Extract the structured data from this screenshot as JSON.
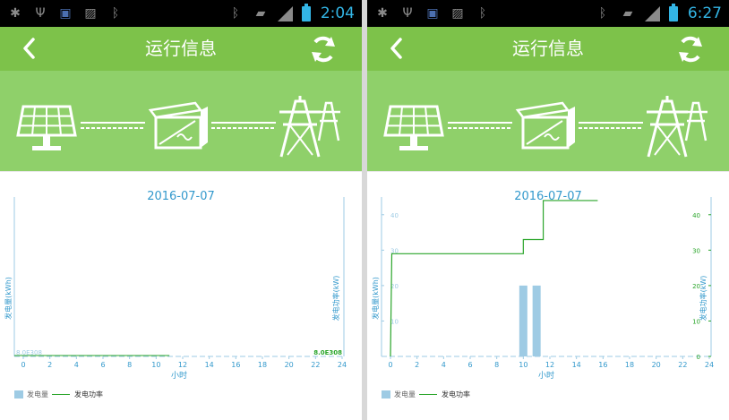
{
  "screens": [
    {
      "status": {
        "time": "2:04",
        "battery_level": 0.85
      },
      "header": {
        "title": "运行信息",
        "back_icon": "chevron-left-icon",
        "refresh_icon": "refresh-icon"
      },
      "chart": {
        "date": "2016-07-07",
        "left_axis_label": "发电量(kWh)",
        "right_axis_label": "发电功率(kW)",
        "x_axis_label": "小时",
        "left_min_label": "8.0E308",
        "right_min_label": "8.0E308",
        "legend": {
          "bars": "发电量",
          "line": "发电功率"
        }
      }
    },
    {
      "status": {
        "time": "6:27",
        "battery_level": 0.6
      },
      "header": {
        "title": "运行信息",
        "back_icon": "chevron-left-icon",
        "refresh_icon": "refresh-icon"
      },
      "chart": {
        "date": "2016-07-07",
        "left_axis_label": "发电量(kWh)",
        "right_axis_label": "发电功率(kW)",
        "x_axis_label": "小时",
        "legend": {
          "bars": "发电量",
          "line": "发电功率"
        }
      }
    }
  ],
  "chart_data": [
    {
      "type": "bar",
      "x": [
        0,
        2,
        4,
        6,
        8,
        10,
        12,
        14,
        16,
        18,
        20,
        22,
        24
      ],
      "xlim": [
        0,
        24
      ],
      "series": [
        {
          "name": "发电量",
          "type": "bar",
          "values": []
        },
        {
          "name": "发电功率",
          "type": "line",
          "values": []
        }
      ],
      "xlabel": "小时",
      "ylabel": "发电量(kWh)",
      "y2label": "发电功率(kW)",
      "tick_labels_left": [
        "8.0E308"
      ],
      "tick_labels_right": [
        "8.0E308"
      ],
      "grid": false,
      "legend": "bottom-left"
    },
    {
      "type": "bar",
      "x": [
        0,
        2,
        4,
        6,
        8,
        10,
        12,
        14,
        16,
        18,
        20,
        22,
        24
      ],
      "xlim": [
        0,
        24
      ],
      "ylim": [
        0,
        45
      ],
      "y2lim": [
        0,
        45
      ],
      "yticks": [
        0,
        10,
        20,
        30,
        40
      ],
      "series": [
        {
          "name": "发电量",
          "type": "bar",
          "axis": "left",
          "points": [
            {
              "x": 10,
              "y": 20
            },
            {
              "x": 11,
              "y": 20
            }
          ]
        },
        {
          "name": "发电功率",
          "type": "line",
          "axis": "right",
          "points": [
            {
              "x": 0,
              "y": 0
            },
            {
              "x": 0.1,
              "y": 29
            },
            {
              "x": 10,
              "y": 29
            },
            {
              "x": 10,
              "y": 33
            },
            {
              "x": 11.5,
              "y": 33
            },
            {
              "x": 11.5,
              "y": 44
            },
            {
              "x": 15.6,
              "y": 44
            }
          ]
        }
      ],
      "xlabel": "小时",
      "ylabel": "发电量(kWh)",
      "y2label": "发电功率(kW)",
      "grid": false,
      "legend": "bottom-left"
    }
  ]
}
